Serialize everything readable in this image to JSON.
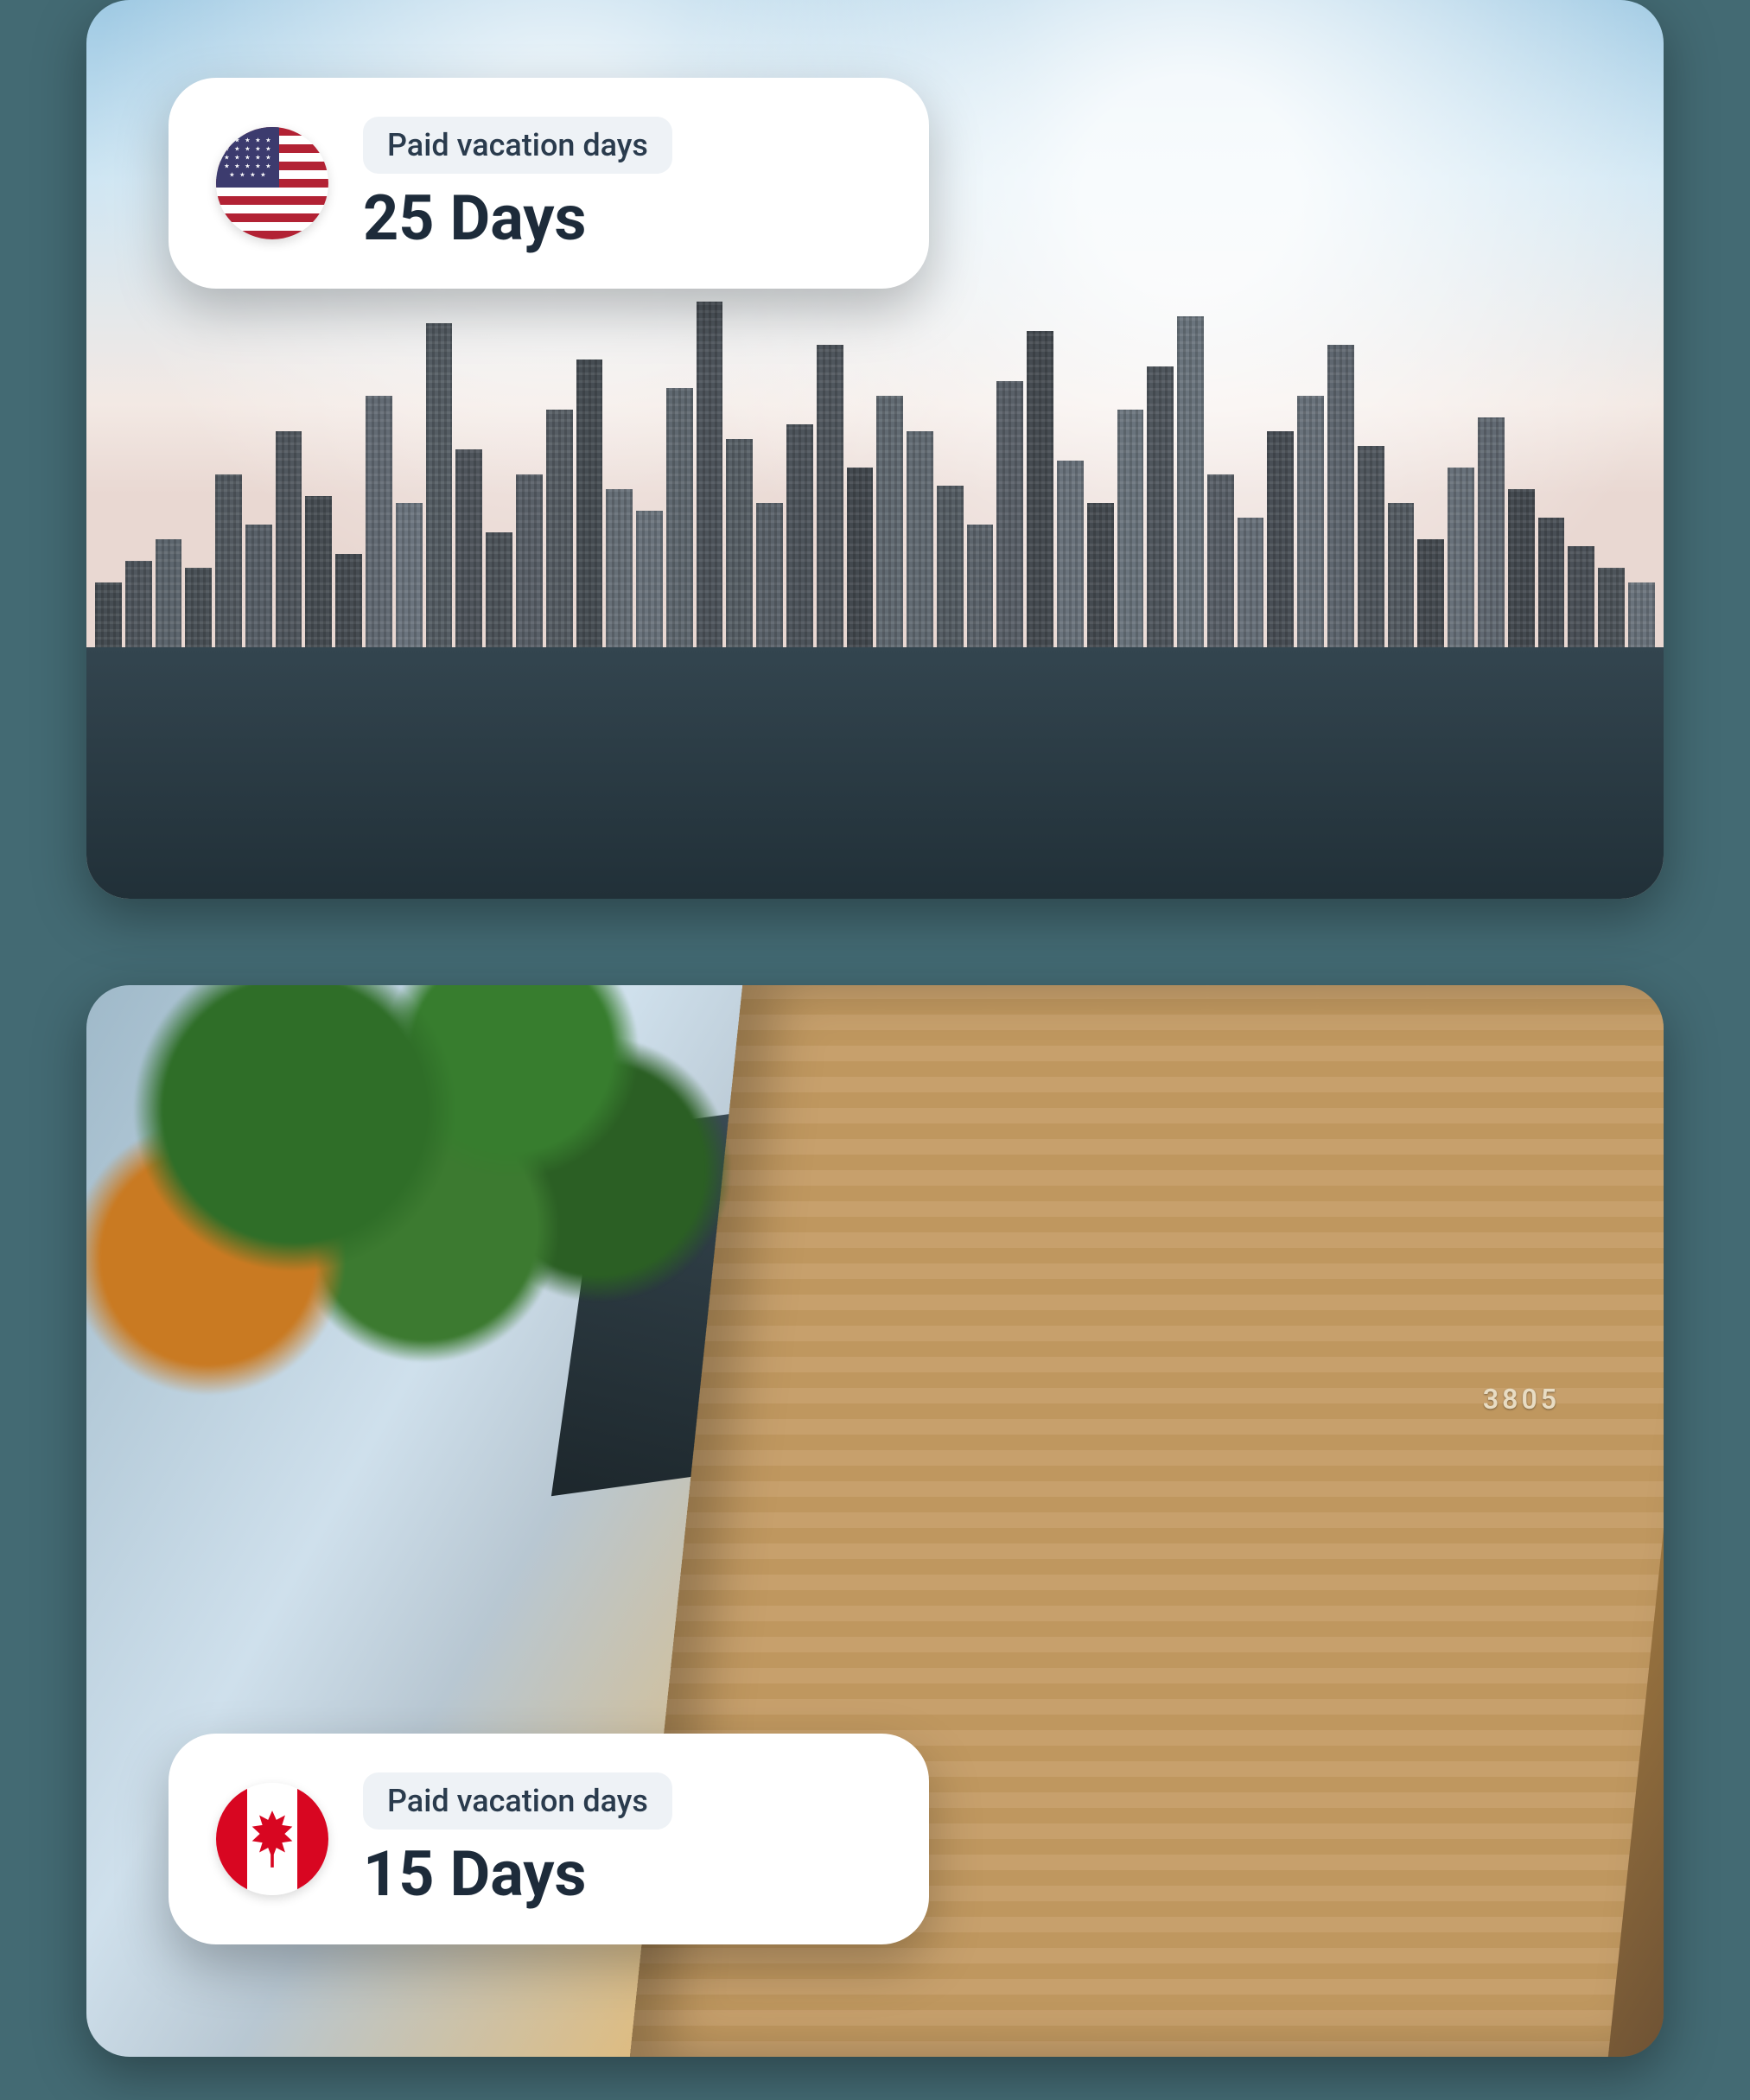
{
  "cards": [
    {
      "country": "us",
      "label": "Paid vacation days",
      "value": "25 Days"
    },
    {
      "country": "ca",
      "label": "Paid vacation days",
      "value": "15 Days"
    }
  ],
  "decor": {
    "house_number": "3805"
  }
}
